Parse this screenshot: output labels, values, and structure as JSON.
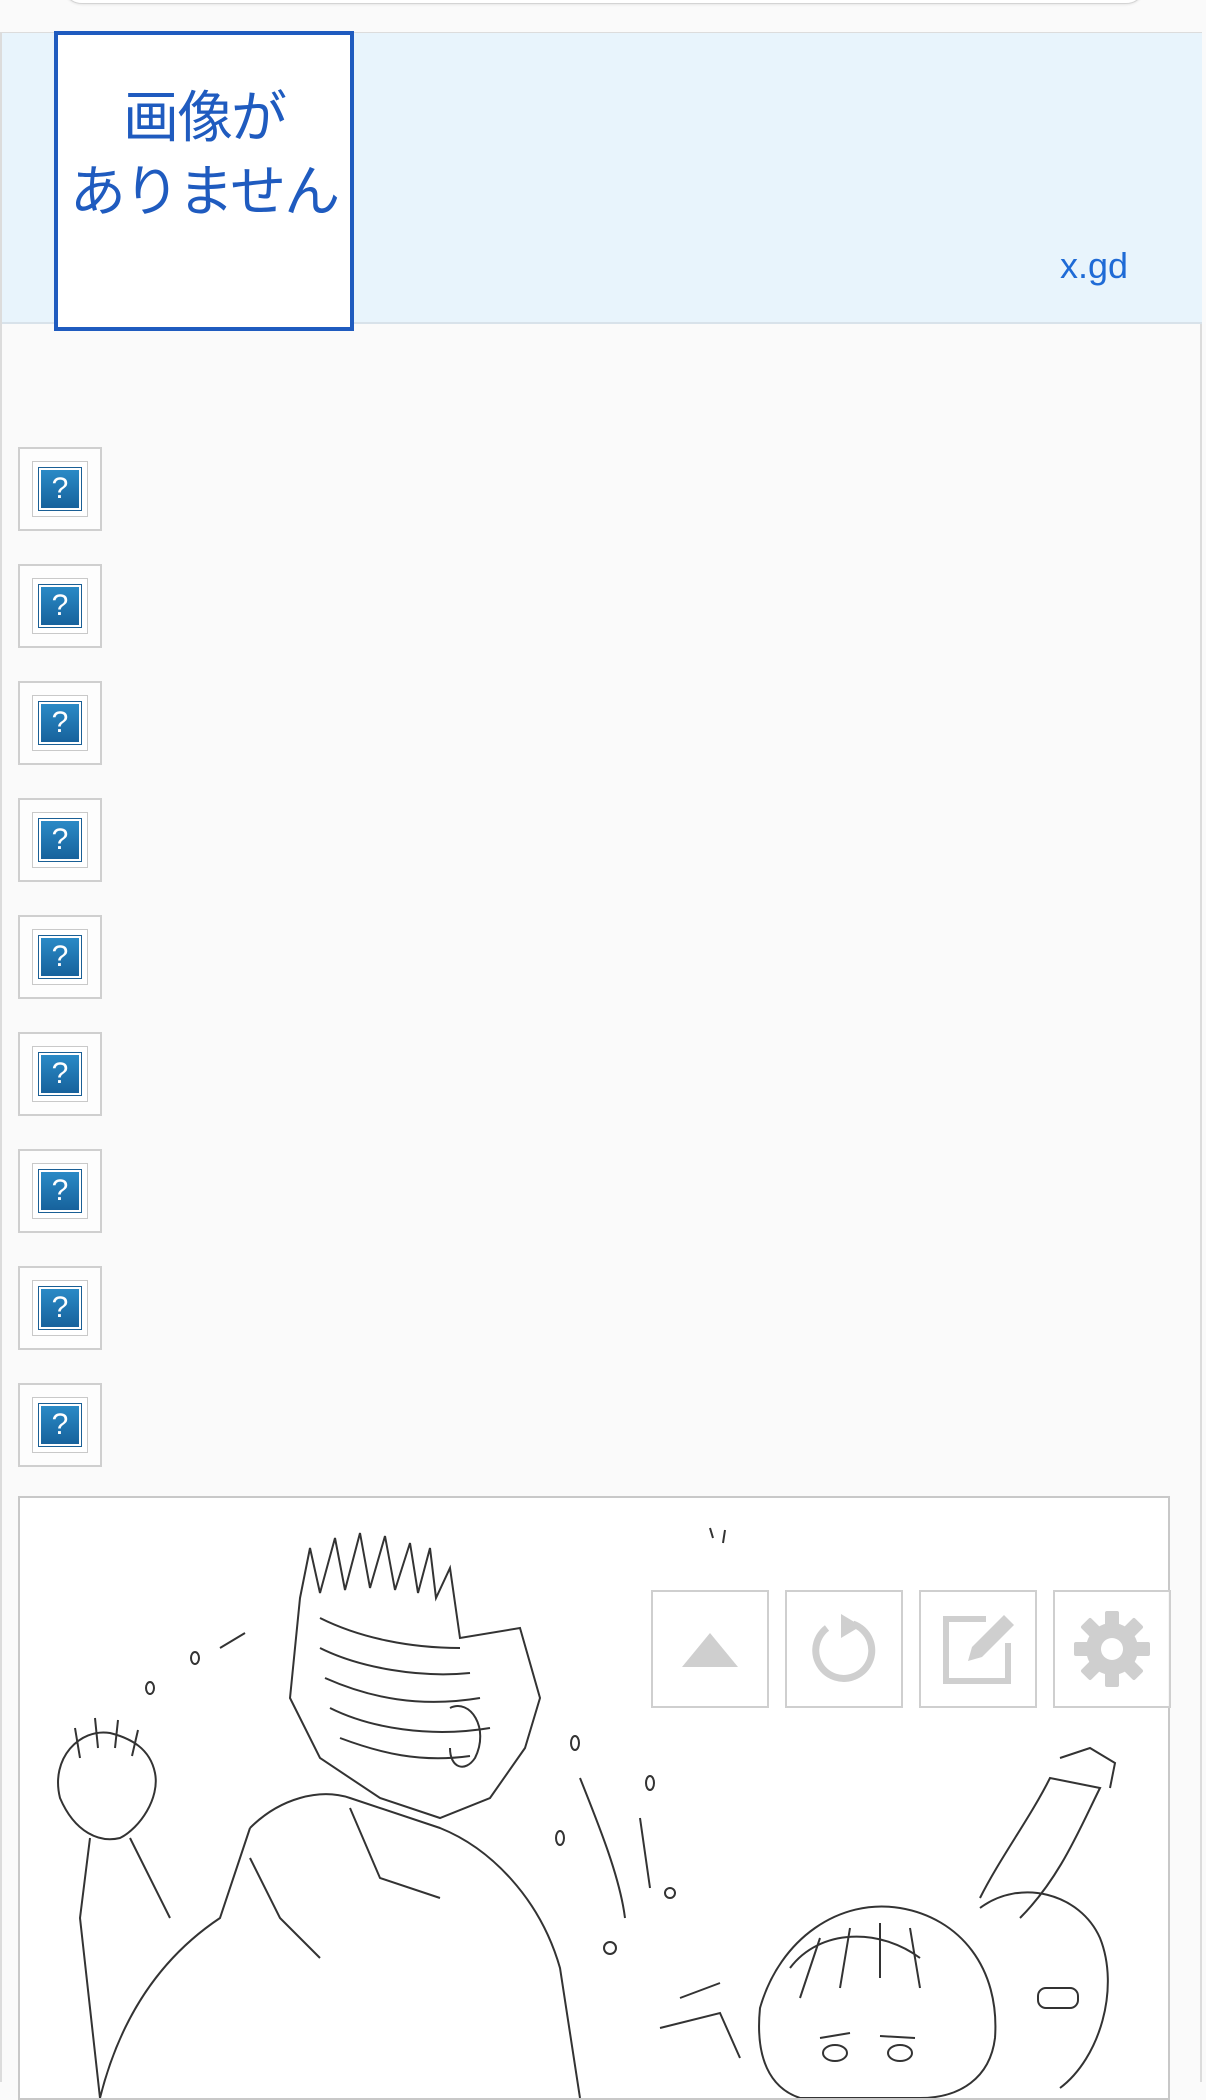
{
  "ad": {
    "no_image_line1": "画像が",
    "no_image_line2": "ありません",
    "domain": "x.gd"
  },
  "icons": [
    {
      "label": "?",
      "icon": "question-icon"
    },
    {
      "label": "?",
      "icon": "question-icon"
    },
    {
      "label": "?",
      "icon": "question-icon"
    },
    {
      "label": "?",
      "icon": "question-icon"
    },
    {
      "label": "?",
      "icon": "question-icon"
    },
    {
      "label": "?",
      "icon": "question-icon"
    },
    {
      "label": "?",
      "icon": "question-icon"
    },
    {
      "label": "?",
      "icon": "question-icon"
    },
    {
      "label": "?",
      "icon": "question-icon"
    }
  ],
  "toolbar": {
    "buttons": [
      "triangle-up-icon",
      "refresh-icon",
      "edit-icon",
      "gear-icon"
    ]
  },
  "colors": {
    "accent": "#1f5bbf",
    "banner_bg": "#e8f4fc",
    "question_blue": "#1f74b3"
  }
}
